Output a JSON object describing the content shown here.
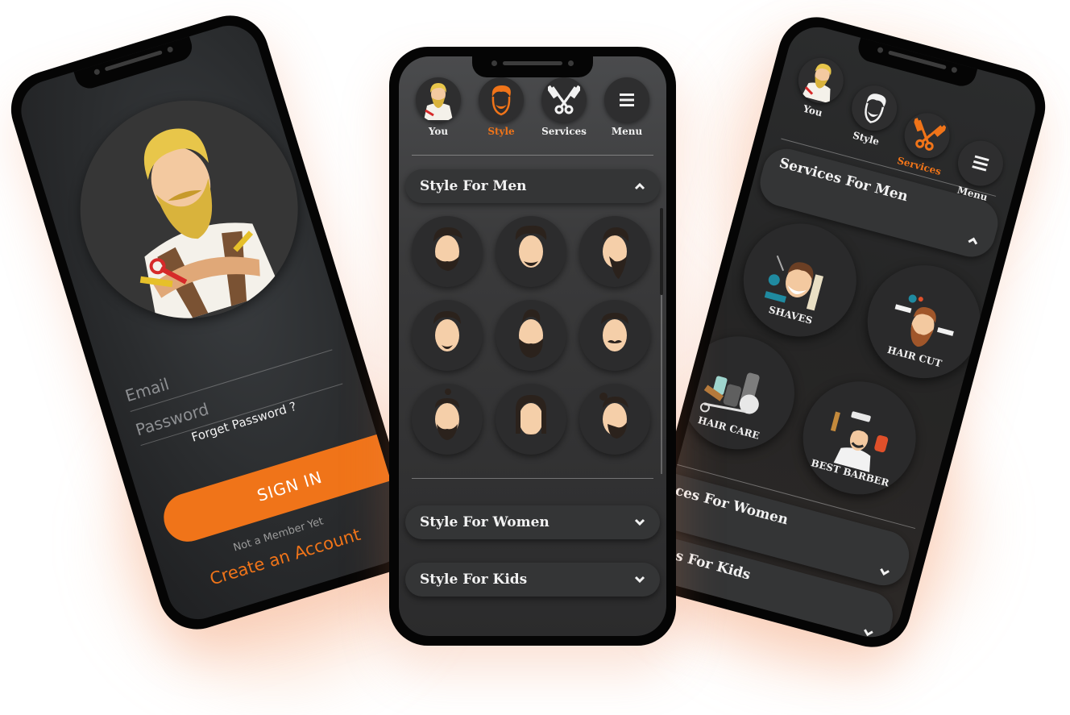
{
  "theme": {
    "accent": "#f07419",
    "background": "#ffffff",
    "screen": "#2f3032",
    "bezel": "#050505"
  },
  "login_screen": {
    "avatar_icon": "barber-mascot",
    "email_placeholder": "Email",
    "password_placeholder": "Password",
    "forget_password": "Forget Password ?",
    "sign_in": "SIGN IN",
    "not_member": "Not a Member Yet",
    "create_account": "Create an Account"
  },
  "style_screen": {
    "nav": [
      {
        "label": "You",
        "icon": "barber-avatar-icon",
        "active": false
      },
      {
        "label": "Style",
        "icon": "beard-face-icon",
        "active": true
      },
      {
        "label": "Services",
        "icon": "scissors-comb-icon",
        "active": false
      },
      {
        "label": "Menu",
        "icon": "hamburger-menu-icon",
        "active": false
      }
    ],
    "sections": [
      {
        "title": "Style For Men",
        "expanded": true
      },
      {
        "title": "Style For Women",
        "expanded": false
      },
      {
        "title": "Style For Kids",
        "expanded": false
      }
    ],
    "hairstyles": [
      "undercut-full-beard",
      "quiff-chin-beard",
      "slick-back-long-beard",
      "pompadour-goatee",
      "mohawk-full-beard",
      "side-part-mustache",
      "top-knot-beard",
      "long-hair-stubble",
      "man-bun-beard"
    ]
  },
  "services_screen": {
    "nav": [
      {
        "label": "You",
        "icon": "barber-avatar-icon",
        "active": false
      },
      {
        "label": "Style",
        "icon": "beard-face-icon",
        "active": false
      },
      {
        "label": "Services",
        "icon": "scissors-comb-icon",
        "active": true
      },
      {
        "label": "Menu",
        "icon": "hamburger-menu-icon",
        "active": false
      }
    ],
    "sections": [
      {
        "title": "Services For Men",
        "expanded": true
      },
      {
        "title": "Services For Women",
        "expanded": false
      },
      {
        "title": "Services For Kids",
        "expanded": false
      }
    ],
    "services": [
      {
        "label": "SHAVES",
        "icon": "shaving-kit-icon"
      },
      {
        "label": "HAIR CUT",
        "icon": "haircut-icon"
      },
      {
        "label": "HAIR CARE",
        "icon": "hair-care-products-icon"
      },
      {
        "label": "BEST BARBER",
        "icon": "barber-icon"
      }
    ]
  }
}
